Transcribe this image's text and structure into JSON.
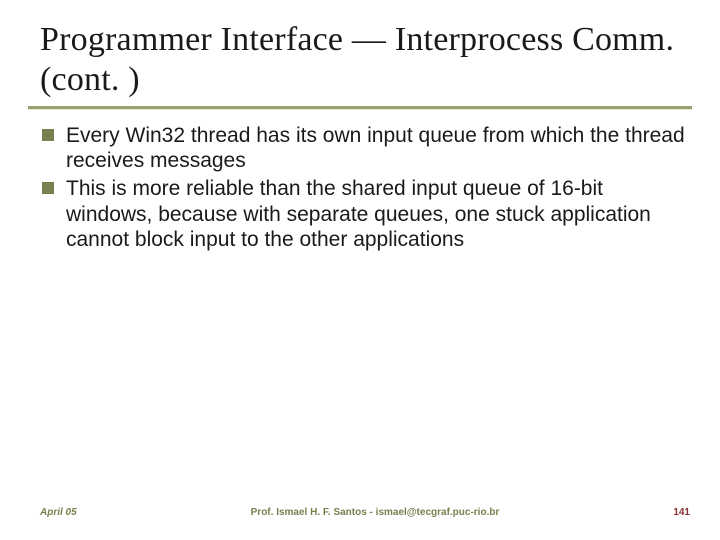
{
  "slide": {
    "title": "Programmer Interface — Interprocess Comm. (cont. )",
    "bullets": [
      "Every Win32 thread has its own input  queue from which the thread receives messages",
      "This is more reliable than the shared input queue of 16-bit windows, because with separate queues, one stuck application cannot block input to the other applications"
    ],
    "footer": {
      "date": "April 05",
      "author": "Prof. Ismael H. F. Santos  -  ismael@tecgraf.puc-rio.br",
      "page": "141"
    }
  }
}
